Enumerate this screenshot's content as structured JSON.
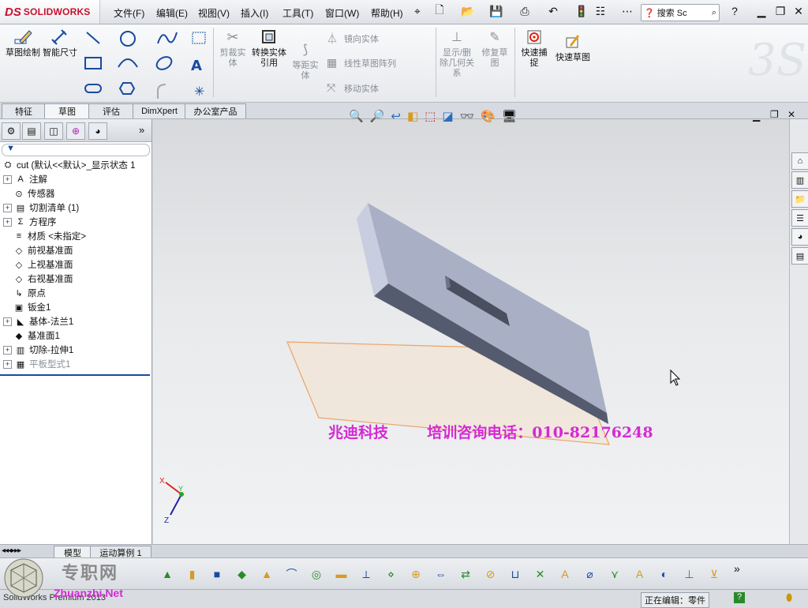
{
  "app": {
    "brand_ds": "DS",
    "brand_name": "SOLIDWORKS"
  },
  "menu": [
    "文件(F)",
    "编辑(E)",
    "视图(V)",
    "插入(I)",
    "工具(T)",
    "窗口(W)",
    "帮助(H)"
  ],
  "search": {
    "placeholder": "搜索 Sc"
  },
  "ribbon": {
    "sketch": "草图绘制",
    "smart_dim": "智能尺寸",
    "trim": "剪裁实体",
    "convert": "转换实体引用",
    "offset": "等距实体",
    "mirror": "镜向实体",
    "linear_pattern": "线性草图阵列",
    "move": "移动实体",
    "display_relations": "显示/删除几何关系",
    "repair": "修复草图",
    "quick_snaps": "快速捕捉",
    "rapid_sketch": "快速草图"
  },
  "tabs": [
    "特征",
    "草图",
    "评估",
    "DimXpert",
    "办公室产品"
  ],
  "tree": {
    "root": "cut  (默认<<默认>_显示状态 1",
    "items": [
      {
        "label": "注解",
        "expand": true,
        "icon": "A"
      },
      {
        "label": "传感器",
        "expand": false,
        "icon": "⊙"
      },
      {
        "label": "切割清单 (1)",
        "expand": true,
        "icon": "▤"
      },
      {
        "label": "方程序",
        "expand": true,
        "icon": "Σ"
      },
      {
        "label": "材质 <未指定>",
        "expand": false,
        "icon": "≡"
      },
      {
        "label": "前视基准面",
        "expand": false,
        "icon": "◇"
      },
      {
        "label": "上视基准面",
        "expand": false,
        "icon": "◇"
      },
      {
        "label": "右视基准面",
        "expand": false,
        "icon": "◇"
      },
      {
        "label": "原点",
        "expand": false,
        "icon": "↳"
      },
      {
        "label": "钣金1",
        "expand": false,
        "icon": "▣"
      },
      {
        "label": "基体-法兰1",
        "expand": true,
        "icon": "◣"
      },
      {
        "label": "基准面1",
        "expand": false,
        "icon": "◆"
      },
      {
        "label": "切除-拉伸1",
        "expand": true,
        "icon": "▥"
      },
      {
        "label": "平板型式1",
        "expand": true,
        "icon": "▦",
        "dim": true
      }
    ]
  },
  "bottom_tabs": [
    "模型",
    "运动算例 1"
  ],
  "watermark": {
    "company": "兆迪科技",
    "phone": "培训咨询电话：010-82176248",
    "site_cn": "专职网",
    "site_url": "Zhuanzhi.Net"
  },
  "status": {
    "left": "SolidWorks Premium 2013",
    "editing": "正在编辑：零件",
    "help": "?"
  },
  "triad": {
    "x": "X",
    "y": "Y",
    "z": "Z"
  },
  "colors": {
    "brand": "#c8102e",
    "watermark": "#d42ad4",
    "part": "#a9b0c6",
    "plane": "#e8a56a"
  }
}
